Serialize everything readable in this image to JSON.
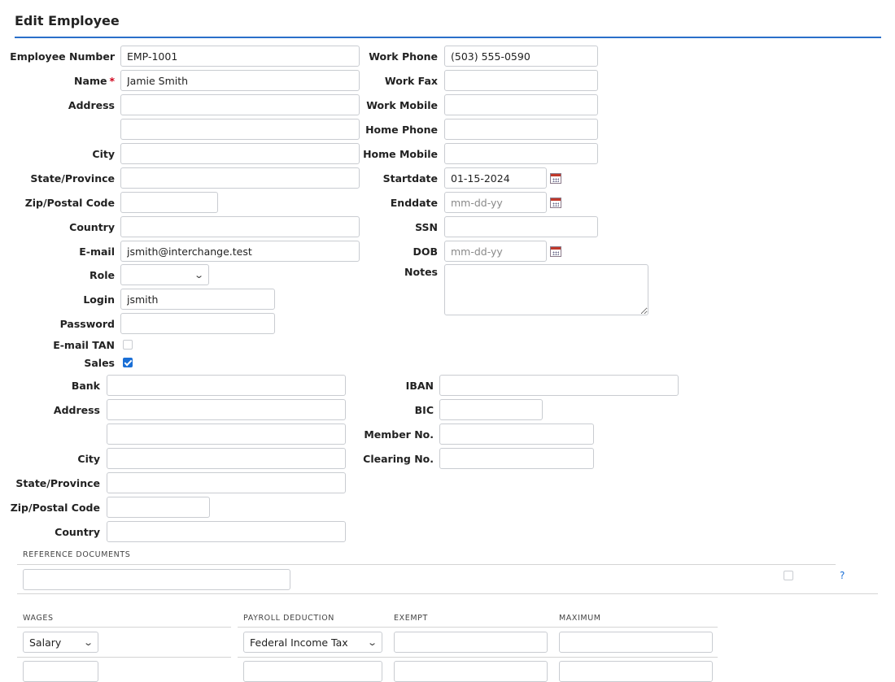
{
  "page": {
    "title": "Edit Employee"
  },
  "employee": {
    "number_label": "Employee Number",
    "number_value": "EMP-1001",
    "name_label": "Name",
    "name_required": "*",
    "name_value": "Jamie Smith",
    "address_label": "Address",
    "address1_value": "",
    "address2_value": "",
    "city_label": "City",
    "city_value": "",
    "state_label": "State/Province",
    "state_value": "",
    "zip_label": "Zip/Postal Code",
    "zip_value": "",
    "country_label": "Country",
    "country_value": "",
    "email_label": "E-mail",
    "email_value": "jsmith@interchange.test",
    "role_label": "Role",
    "role_value": "",
    "login_label": "Login",
    "login_value": "jsmith",
    "password_label": "Password",
    "password_value": "",
    "email_tan_label": "E-mail TAN",
    "email_tan_checked": false,
    "sales_label": "Sales",
    "sales_checked": true
  },
  "contact": {
    "work_phone_label": "Work Phone",
    "work_phone_value": "(503) 555-0590",
    "work_fax_label": "Work Fax",
    "work_fax_value": "",
    "work_mobile_label": "Work Mobile",
    "work_mobile_value": "",
    "home_phone_label": "Home Phone",
    "home_phone_value": "",
    "home_mobile_label": "Home Mobile",
    "home_mobile_value": "",
    "startdate_label": "Startdate",
    "startdate_value": "01-15-2024",
    "enddate_label": "Enddate",
    "enddate_value": "",
    "enddate_placeholder": "mm-dd-yy",
    "ssn_label": "SSN",
    "ssn_value": "",
    "dob_label": "DOB",
    "dob_value": "",
    "dob_placeholder": "mm-dd-yy",
    "notes_label": "Notes",
    "notes_value": ""
  },
  "bank": {
    "bank_label": "Bank",
    "bank_value": "",
    "address_label": "Address",
    "address1_value": "",
    "address2_value": "",
    "city_label": "City",
    "city_value": "",
    "state_label": "State/Province",
    "state_value": "",
    "zip_label": "Zip/Postal Code",
    "zip_value": "",
    "country_label": "Country",
    "country_value": "",
    "iban_label": "IBAN",
    "iban_value": "",
    "bic_label": "BIC",
    "bic_value": "",
    "member_label": "Member No.",
    "member_value": "",
    "clearing_label": "Clearing No.",
    "clearing_value": ""
  },
  "reference_documents": {
    "header": "Reference Documents",
    "value": "",
    "checked": false,
    "help": "?"
  },
  "wages": {
    "header_wages": "Wages",
    "header_deduction": "Payroll Deduction",
    "header_exempt": "Exempt",
    "header_maximum": "Maximum",
    "rows": [
      {
        "wage": "Salary",
        "deduction": "Federal Income Tax",
        "exempt": "",
        "maximum": ""
      }
    ]
  },
  "icons": {
    "calendar": "calendar-icon",
    "chevron": "chevron-down-icon",
    "check": "check-icon",
    "help": "help-icon"
  }
}
